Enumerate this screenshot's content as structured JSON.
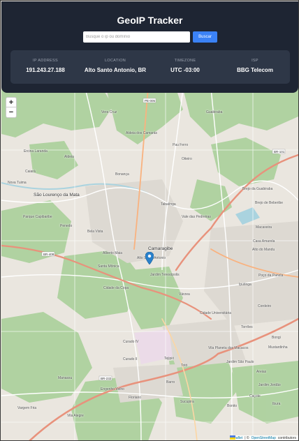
{
  "header": {
    "title": "GeoIP Tracker",
    "search": {
      "placeholder": "Busque o ip ou domínio",
      "value": ""
    },
    "search_button": "Buscar"
  },
  "info": [
    {
      "label": "IP ADDRESS",
      "value": "191.243.27.188"
    },
    {
      "label": "LOCATION",
      "value": "Alto Santo Antonio, BR"
    },
    {
      "label": "TIMEZONE",
      "value": "UTC -03:00"
    },
    {
      "label": "ISP",
      "value": "BBG Telecom"
    }
  ],
  "map": {
    "zoom_in": "+",
    "zoom_out": "−",
    "places": [
      "Vera Cruz",
      "Guabiraba",
      "Aldeia dos Camarás",
      "Pau Ferro",
      "Ercina Laranda",
      "Aldeia",
      "Caiará",
      "Oiteiro",
      "Nova Tuima",
      "São Lourenço da Mata",
      "Bonança",
      "Tabatinga",
      "Brejo da Guabiraba",
      "Brejo de Beberibe",
      "Parque Capibaribe",
      "Penedo",
      "Bela Vista",
      "Camaragibe",
      "Vale das Pedreiras",
      "Macaxeira",
      "Alberto Maia",
      "Alto Santo Antonio",
      "Casa Amarela",
      "Alto do Mandu",
      "Santa Mônica",
      "Jardim Teresópolis",
      "Poço da Panela",
      "Cidade da Copa",
      "Várzea",
      "Iputinga",
      "Cordeiro",
      "Cidade Universitária",
      "Torrões",
      "Curado IV",
      "Curado II",
      "Vila Planeta dos Macacos",
      "Jardim São Paulo",
      "Tejipió",
      "Totó",
      "Barro",
      "Manassu",
      "Engenho Velho",
      "Floriano",
      "Sucupira",
      "Vargem Fria",
      "Vila Alegre",
      "Bonito",
      "Jardim Jordão",
      "Ibura",
      "Mustardinha",
      "Bongi",
      "Areias",
      "Caçote"
    ],
    "road_tags": [
      "PE-005",
      "BR-101",
      "BR-408",
      "BR-232"
    ]
  },
  "attribution": {
    "leaflet": "Leaflet",
    "separator": "| ©",
    "osm": "OpenStreetMap",
    "suffix": "contributors"
  },
  "colors": {
    "header_bg": "#1e2533",
    "card_bg": "#2e3747",
    "button": "#3b82f6",
    "map_forest": "#add19e",
    "marker": "#2a81cb"
  },
  "icons": [
    "map-marker-icon",
    "ukraine-flag-icon"
  ]
}
